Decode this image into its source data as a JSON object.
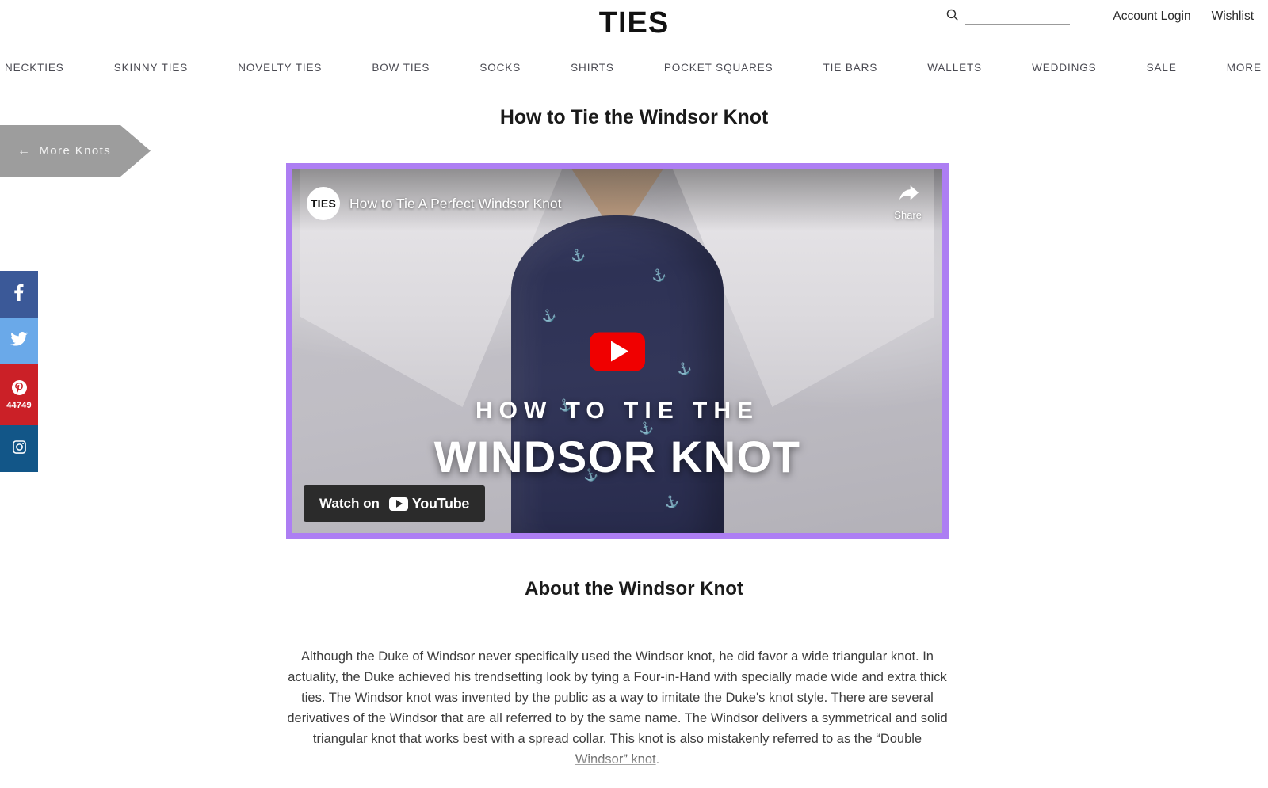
{
  "header": {
    "logo": "TIES",
    "search": {
      "value": "",
      "placeholder": "",
      "icon": "search-icon"
    },
    "account_login": "Account Login",
    "wishlist": "Wishlist"
  },
  "nav": {
    "items": [
      {
        "label": "NECKTIES"
      },
      {
        "label": "SKINNY TIES"
      },
      {
        "label": "NOVELTY TIES"
      },
      {
        "label": "BOW TIES"
      },
      {
        "label": "SOCKS"
      },
      {
        "label": "SHIRTS"
      },
      {
        "label": "POCKET SQUARES"
      },
      {
        "label": "TIE BARS"
      },
      {
        "label": "WALLETS"
      },
      {
        "label": "WEDDINGS"
      },
      {
        "label": "SALE"
      },
      {
        "label": "MORE"
      }
    ]
  },
  "ribbon": {
    "label": "More Knots",
    "arrow": "←",
    "color": "#9d9d9d"
  },
  "social": [
    {
      "name": "facebook",
      "icon": "facebook-icon",
      "glyph": "f",
      "color": "#3b5998",
      "count": ""
    },
    {
      "name": "twitter",
      "icon": "twitter-icon",
      "glyph": "",
      "color": "#6aa9e9",
      "count": ""
    },
    {
      "name": "pinterest",
      "icon": "pinterest-icon",
      "glyph": "",
      "color": "#cb2027",
      "count": "44749"
    },
    {
      "name": "instagram",
      "icon": "instagram-icon",
      "glyph": "",
      "color": "#125688",
      "count": ""
    }
  ],
  "main": {
    "page_title": "How to Tie the Windsor Knot",
    "about_title": "About the Windsor Knot"
  },
  "video": {
    "border_color": "#ad7ef3",
    "channel_avatar_text": "TIES",
    "title": "How to Tie A Perfect Windsor Knot",
    "share_label": "Share",
    "play_button": "play-button",
    "overlay_line1": "HOW TO TIE THE",
    "overlay_line2": "WINDSOR KNOT",
    "watch_on_label": "Watch on",
    "youtube_label": "YouTube"
  },
  "article": {
    "paragraph_part1": "Although the Duke of Windsor never specifically used the Windsor knot, he did favor a wide triangular knot. In actuality, the Duke achieved his trendsetting look by tying a Four-in-Hand with specially made wide and extra thick ties. The Windsor knot was invented by the public as a way to imitate the Duke's knot style. There are several derivatives of the Windsor that are all referred to by the same name. The Windsor delivers a symmetrical and solid triangular knot that works best with a spread collar. This knot is also mistakenly referred to as the ",
    "link_text": "“Double Windsor” knot",
    "paragraph_part2": "."
  }
}
